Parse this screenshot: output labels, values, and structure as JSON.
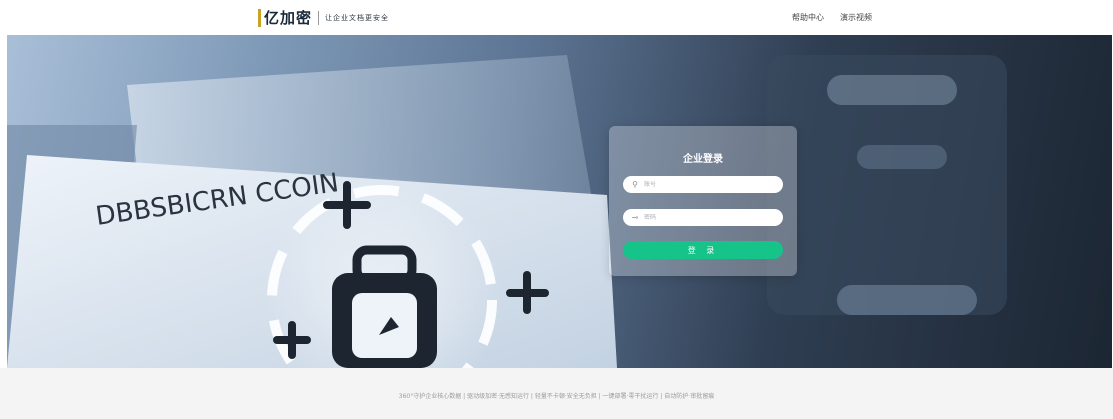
{
  "header": {
    "logo_text": "亿加密",
    "slogan": "让企业文档更安全",
    "nav": [
      {
        "label": "帮助中心"
      },
      {
        "label": "演示视频"
      }
    ]
  },
  "login": {
    "title": "企业登录",
    "username_placeholder": "账号",
    "password_placeholder": "密码",
    "submit_label": "登 录"
  },
  "footer": {
    "text": "360°守护企业核心数据 | 驱动级加密·无感知运行 | 轻量不卡顿·安全无负担 | 一键部署·零干扰运行 | 自动防护·审批留痕"
  },
  "colors": {
    "primary_button": "#16c48a",
    "footer_bg": "#f4f4f4"
  },
  "icons": {
    "username": "user-icon",
    "password": "key-icon"
  }
}
